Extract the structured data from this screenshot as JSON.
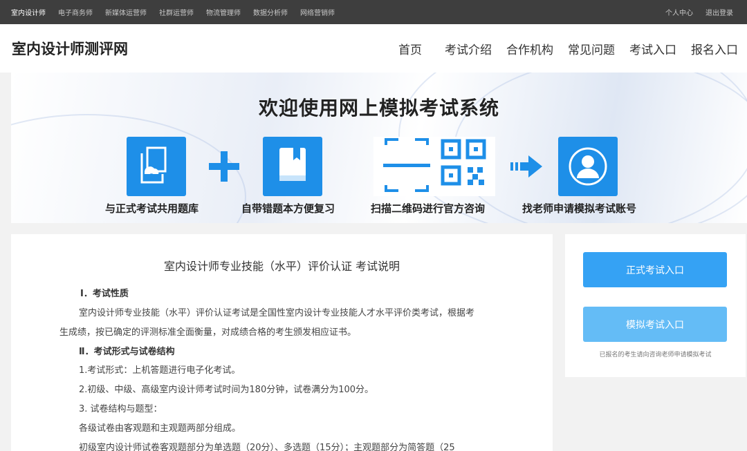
{
  "topbar": {
    "links": [
      "室内设计师",
      "电子商务师",
      "新媒体运营师",
      "社群运营师",
      "物流管理师",
      "数据分析师",
      "网络营销师"
    ],
    "user_center": "个人中心",
    "logout": "退出登录"
  },
  "header": {
    "logo": "室内设计师测评网",
    "nav": [
      "首页",
      "考试介绍",
      "合作机构",
      "常见问题",
      "考试入口",
      "报名入口"
    ]
  },
  "banner": {
    "title": "欢迎使用网上模拟考试系统",
    "features": [
      "与正式考试共用题库",
      "自带错题本方便复习",
      "扫描二维码进行官方咨询",
      "找老师申请模拟考试账号"
    ]
  },
  "doc": {
    "title": "室内设计师专业技能（水平）评价认证 考试说明",
    "sec1_heading": "Ⅰ．考试性质",
    "sec1_p1": "室内设计师专业技能（水平）评价认证考试是全国性室内设计专业技能人才水平评价类考试，根据考",
    "sec1_p2": "生成绩，按已确定的评测标准全面衡量，对成绩合格的考生颁发相应证书。",
    "sec2_heading": "Ⅱ．考试形式与试卷结构",
    "item1": "1.考试形式：上机答题进行电子化考试。",
    "item2": "2.初级、中级、高级室内设计师考试时间为180分钟，试卷满分为100分。",
    "item3": "3. 试卷结构与题型：",
    "item3_p1": "各级试卷由客观题和主观题两部分组成。",
    "item3_p2": "初级室内设计师试卷客观题部分为单选题（20分）、多选题（15分）；主观题部分为简答题（25"
  },
  "side": {
    "formal_exam": "正式考试入口",
    "mock_exam": "模拟考试入口",
    "note": "已报名的考生请向咨询老师申请模拟考试"
  },
  "colors": {
    "topbar": "#3e3e3e",
    "accent_blue": "#1e8fe8",
    "button_primary": "#35a2f4",
    "button_secondary": "#64bcf6"
  }
}
